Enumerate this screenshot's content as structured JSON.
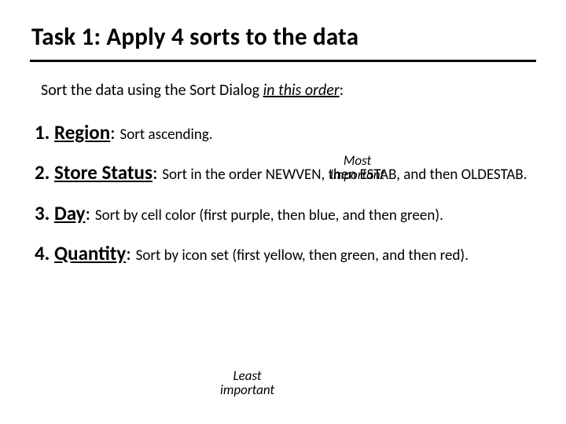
{
  "title": "Task 1: Apply 4 sorts to the data",
  "intro": {
    "prefix": "Sort the data using the Sort Dialog ",
    "suffix": "in this order",
    "tail": ":"
  },
  "items": [
    {
      "num": "1. ",
      "key": "Region",
      "colon": ": ",
      "desc": "Sort ascending."
    },
    {
      "num": "2. ",
      "key": "Store Status",
      "colon": ": ",
      "desc": "Sort in the order NEWVEN, then ESTAB, and then OLDESTAB."
    },
    {
      "num": "3. ",
      "key": "Day",
      "colon": ": ",
      "desc": "Sort by cell color (first purple, then blue, and then green)."
    },
    {
      "num": "4. ",
      "key": "Quantity",
      "colon": ": ",
      "desc": "Sort by icon set (first yellow, then green, and then red)."
    }
  ],
  "notes": {
    "most": "Most\nimportant",
    "least": "Least\nimportant"
  }
}
